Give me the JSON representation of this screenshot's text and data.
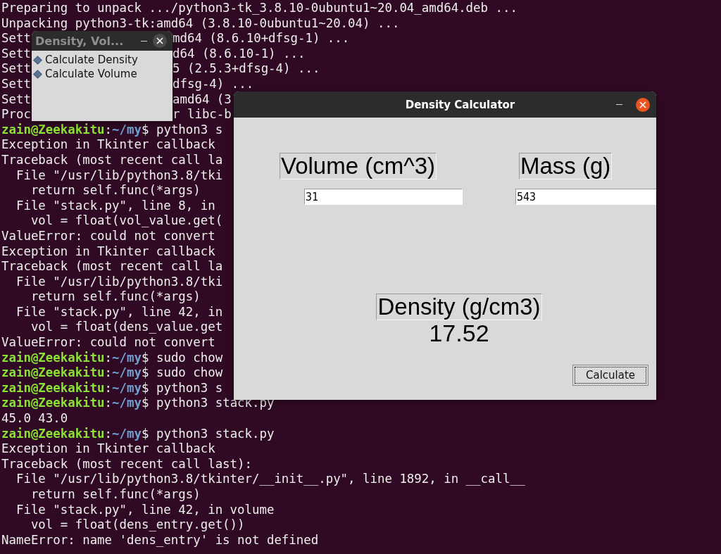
{
  "terminal": {
    "lines": [
      {
        "kind": "output",
        "text": "Preparing to unpack .../python3-tk_3.8.10-0ubuntu1~20.04_amd64.deb ..."
      },
      {
        "kind": "output",
        "text": "Unpacking python3-tk:amd64 (3.8.10-0ubuntu1~20.04) ..."
      },
      {
        "kind": "split",
        "segments": [
          "Sett",
          "md64 (8.6.10+dfsg-1) ..."
        ]
      },
      {
        "kind": "split",
        "segments": [
          "Sett",
          "d64 (8.6.10-1) ..."
        ]
      },
      {
        "kind": "split",
        "segments": [
          "Sett",
          "5 (2.5.3+dfsg-4) ..."
        ]
      },
      {
        "kind": "split",
        "segments": [
          "Sett",
          "dfsg-4) ..."
        ]
      },
      {
        "kind": "split",
        "segments": [
          "Sett",
          "amd64 (3"
        ]
      },
      {
        "kind": "split",
        "segments": [
          "Proc",
          "r libc-b"
        ]
      },
      {
        "kind": "prompt",
        "user": "zain@Zeekakitu",
        "sep": ":",
        "path": "~/my",
        "mark": "$",
        "text": "python3 s"
      },
      {
        "kind": "output",
        "text": "Exception in Tkinter callback"
      },
      {
        "kind": "output",
        "text": "Traceback (most recent call la"
      },
      {
        "kind": "output",
        "text": "  File \"/usr/lib/python3.8/tki"
      },
      {
        "kind": "output",
        "text": "    return self.func(*args)"
      },
      {
        "kind": "output",
        "text": "  File \"stack.py\", line 8, in"
      },
      {
        "kind": "output",
        "text": "    vol = float(vol_value.get("
      },
      {
        "kind": "output",
        "text": "ValueError: could not convert"
      },
      {
        "kind": "output",
        "text": "Exception in Tkinter callback"
      },
      {
        "kind": "output",
        "text": "Traceback (most recent call la"
      },
      {
        "kind": "output",
        "text": "  File \"/usr/lib/python3.8/tki"
      },
      {
        "kind": "output",
        "text": "    return self.func(*args)"
      },
      {
        "kind": "output",
        "text": "  File \"stack.py\", line 42, in"
      },
      {
        "kind": "output",
        "text": "    vol = float(dens_value.get"
      },
      {
        "kind": "output",
        "text": "ValueError: could not convert"
      },
      {
        "kind": "prompt",
        "user": "zain@Zeekakitu",
        "sep": ":",
        "path": "~/my",
        "mark": "$",
        "text": "sudo chow"
      },
      {
        "kind": "prompt",
        "user": "zain@Zeekakitu",
        "sep": ":",
        "path": "~/my",
        "mark": "$",
        "text": "sudo chow"
      },
      {
        "kind": "prompt",
        "user": "zain@Zeekakitu",
        "sep": ":",
        "path": "~/my",
        "mark": "$",
        "text": "python3 s"
      },
      {
        "kind": "prompt",
        "user": "zain@Zeekakitu",
        "sep": ":",
        "path": "~/my",
        "mark": "$",
        "text": "python3 stack.py"
      },
      {
        "kind": "output",
        "text": "45.0 43.0"
      },
      {
        "kind": "prompt",
        "user": "zain@Zeekakitu",
        "sep": ":",
        "path": "~/my",
        "mark": "$",
        "text": "python3 stack.py"
      },
      {
        "kind": "output",
        "text": "Exception in Tkinter callback"
      },
      {
        "kind": "output",
        "text": "Traceback (most recent call last):"
      },
      {
        "kind": "output",
        "text": "  File \"/usr/lib/python3.8/tkinter/__init__.py\", line 1892, in __call__"
      },
      {
        "kind": "output",
        "text": "    return self.func(*args)"
      },
      {
        "kind": "output",
        "text": "  File \"stack.py\", line 42, in volume"
      },
      {
        "kind": "output",
        "text": "    vol = float(dens_entry.get())"
      },
      {
        "kind": "output",
        "text": "NameError: name 'dens_entry' is not defined"
      }
    ]
  },
  "menu_window": {
    "title": "Density, Vol...",
    "options": [
      {
        "label": "Calculate Density",
        "selected": false
      },
      {
        "label": "Calculate Volume",
        "selected": false
      }
    ]
  },
  "calculator_window": {
    "title": "Density Calculator",
    "volume": {
      "label": "Volume (cm^3)",
      "value": "31"
    },
    "mass": {
      "label": "Mass (g)",
      "value": "543"
    },
    "density": {
      "label": "Density (g/cm3)",
      "value": "17.52"
    },
    "button": "Calculate"
  }
}
